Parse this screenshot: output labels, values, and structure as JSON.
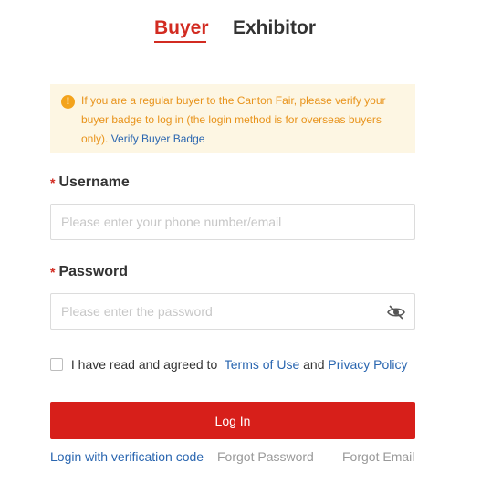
{
  "tabs": {
    "buyer": "Buyer",
    "exhibitor": "Exhibitor"
  },
  "notice": {
    "icon": "warning-icon",
    "text": "If you are a regular buyer to the Canton Fair, please verify your buyer badge to log in (the login method is for overseas buyers only).",
    "link": "Verify Buyer Badge"
  },
  "form": {
    "username_label": "Username",
    "username_placeholder": "Please enter your phone number/email",
    "username_value": "",
    "password_label": "Password",
    "password_placeholder": "Please enter the password",
    "password_value": "",
    "required_mark": "*",
    "password_toggle_icon": "eye-hidden-icon"
  },
  "agreement": {
    "checked": false,
    "prefix": "I have read and agreed to",
    "terms": "Terms of Use",
    "and": "and",
    "privacy": "Privacy Policy"
  },
  "login_button": "Log In",
  "links": {
    "verification_code": "Login with verification code",
    "forgot_password": "Forgot Password",
    "forgot_email": "Forgot Email"
  },
  "colors": {
    "accent": "#d22b21",
    "link": "#2a66b0",
    "notice_bg": "#fdf6e3",
    "notice_text": "#e8931b"
  }
}
